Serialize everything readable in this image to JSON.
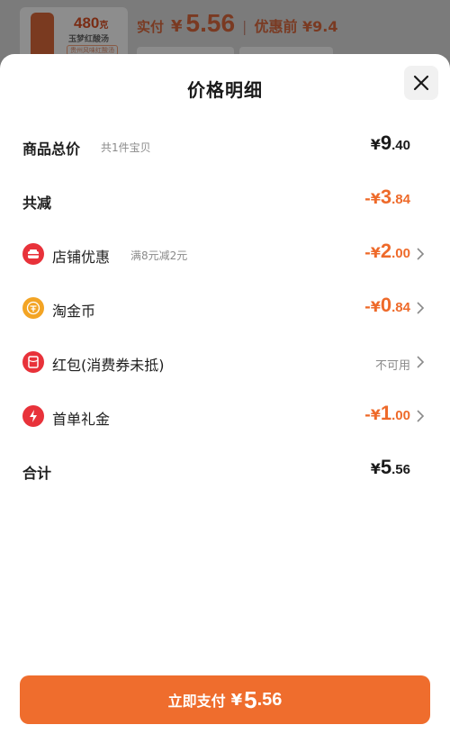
{
  "background": {
    "thumb_big": "480",
    "thumb_unit": "克",
    "thumb_name": "玉梦红酸汤",
    "thumb_tag": "贵州风味红酸汤",
    "pay_label": "实付",
    "pay_yen": "¥",
    "pay_amount": "5.56",
    "separator": "|",
    "orig_label": "优惠前 ¥9.4"
  },
  "sheet": {
    "title": "价格明细",
    "close_icon": "close-icon"
  },
  "rows": {
    "total": {
      "label": "商品总价",
      "sub": "共1件宝贝",
      "sign": "¥",
      "int": "9",
      "dec": ".40"
    },
    "reduce": {
      "label": "共减",
      "sign": "-¥",
      "int": "3",
      "dec": ".84"
    },
    "store": {
      "label": "店铺优惠",
      "sub": "满8元减2元",
      "sign": "-¥",
      "int": "2",
      "dec": ".00",
      "icon": "store-coupon-icon",
      "icon_color": "#e8323a"
    },
    "coin": {
      "label": "淘金币",
      "sign": "-¥",
      "int": "0",
      "dec": ".84",
      "icon": "gold-coin-icon",
      "icon_color": "#f3a424"
    },
    "redpacket": {
      "label": "红包(消费券未抵)",
      "status": "不可用",
      "icon": "red-packet-icon",
      "icon_color": "#e8323a"
    },
    "firstorder": {
      "label": "首单礼金",
      "sign": "-¥",
      "int": "1",
      "dec": ".00",
      "icon": "lightning-icon",
      "icon_color": "#e8323a"
    },
    "sum": {
      "label": "合计",
      "sign": "¥",
      "int": "5",
      "dec": ".56"
    }
  },
  "pay_button": {
    "label": "立即支付",
    "sign": "¥",
    "int": "5",
    "dec": ".56"
  },
  "colors": {
    "accent": "#ef6d2d",
    "discount": "#ee6a2a",
    "icon_red": "#e8323a",
    "coin": "#f3a424"
  }
}
